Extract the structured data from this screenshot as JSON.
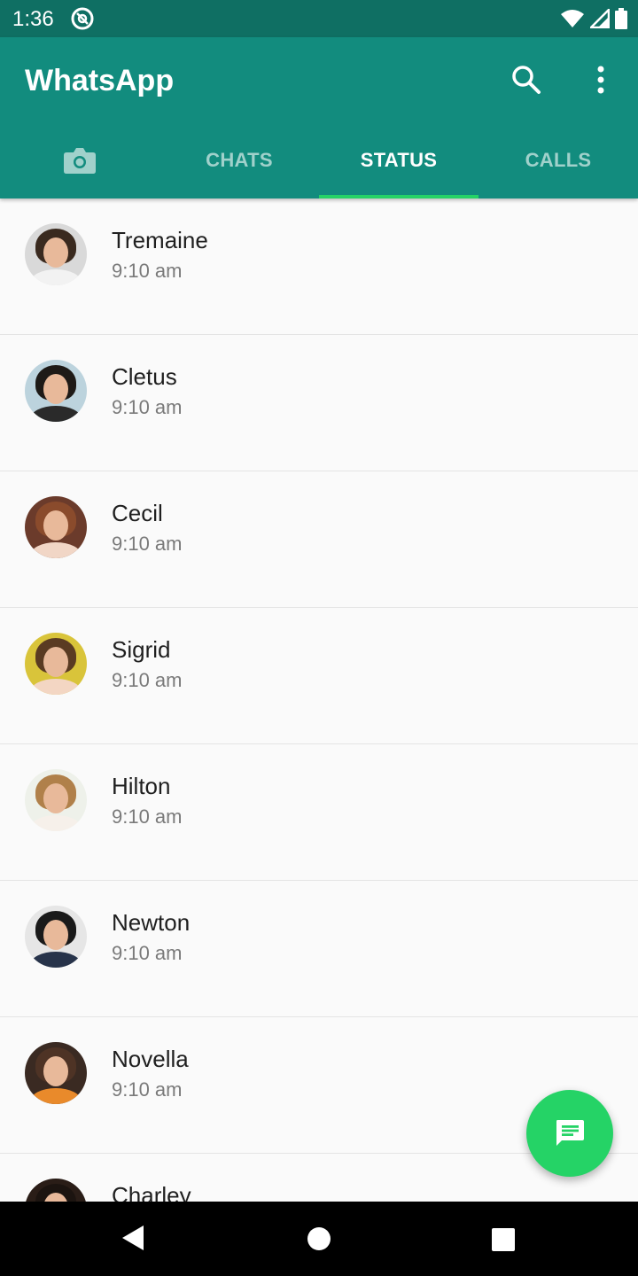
{
  "status_bar": {
    "time": "1:36"
  },
  "app": {
    "title": "WhatsApp"
  },
  "tabs": [
    {
      "id": "camera",
      "label": ""
    },
    {
      "id": "chats",
      "label": "CHATS"
    },
    {
      "id": "status",
      "label": "STATUS",
      "active": true
    },
    {
      "id": "calls",
      "label": "CALLS"
    }
  ],
  "contacts": [
    {
      "name": "Tremaine",
      "time": "9:10 am",
      "bg": "#d9d9d9",
      "hair": "#3a2a1f",
      "shirt": "#f2f2f2"
    },
    {
      "name": "Cletus",
      "time": "9:10 am",
      "bg": "#bcd3dd",
      "hair": "#1e1a17",
      "shirt": "#2a2a2a"
    },
    {
      "name": "Cecil",
      "time": "9:10 am",
      "bg": "#6b3b2b",
      "hair": "#8a4b2c",
      "shirt": "#f1d6c6"
    },
    {
      "name": "Sigrid",
      "time": "9:10 am",
      "bg": "#d9c43a",
      "hair": "#5a3b22",
      "shirt": "#f3d6c3"
    },
    {
      "name": "Hilton",
      "time": "9:10 am",
      "bg": "#eef1ea",
      "hair": "#b0804a",
      "shirt": "#f6f0ea"
    },
    {
      "name": "Newton",
      "time": "9:10 am",
      "bg": "#e6e6e6",
      "hair": "#1a1a1a",
      "shirt": "#27334a"
    },
    {
      "name": "Novella",
      "time": "9:10 am",
      "bg": "#3a2a22",
      "hair": "#4e3325",
      "shirt": "#e98a2b"
    },
    {
      "name": "Charley",
      "time": "",
      "bg": "#2a1d17",
      "hair": "#1c1410",
      "shirt": "#ddd"
    }
  ],
  "icons": {
    "status_at": "at-sign-icon",
    "search": "search-icon",
    "menu": "more-vert-icon",
    "camera": "camera-icon",
    "fab": "message-icon"
  },
  "colors": {
    "status_bar": "#0f6f63",
    "app_bar": "#128c7e",
    "tab_indicator": "#25d366",
    "fab": "#25d366"
  }
}
